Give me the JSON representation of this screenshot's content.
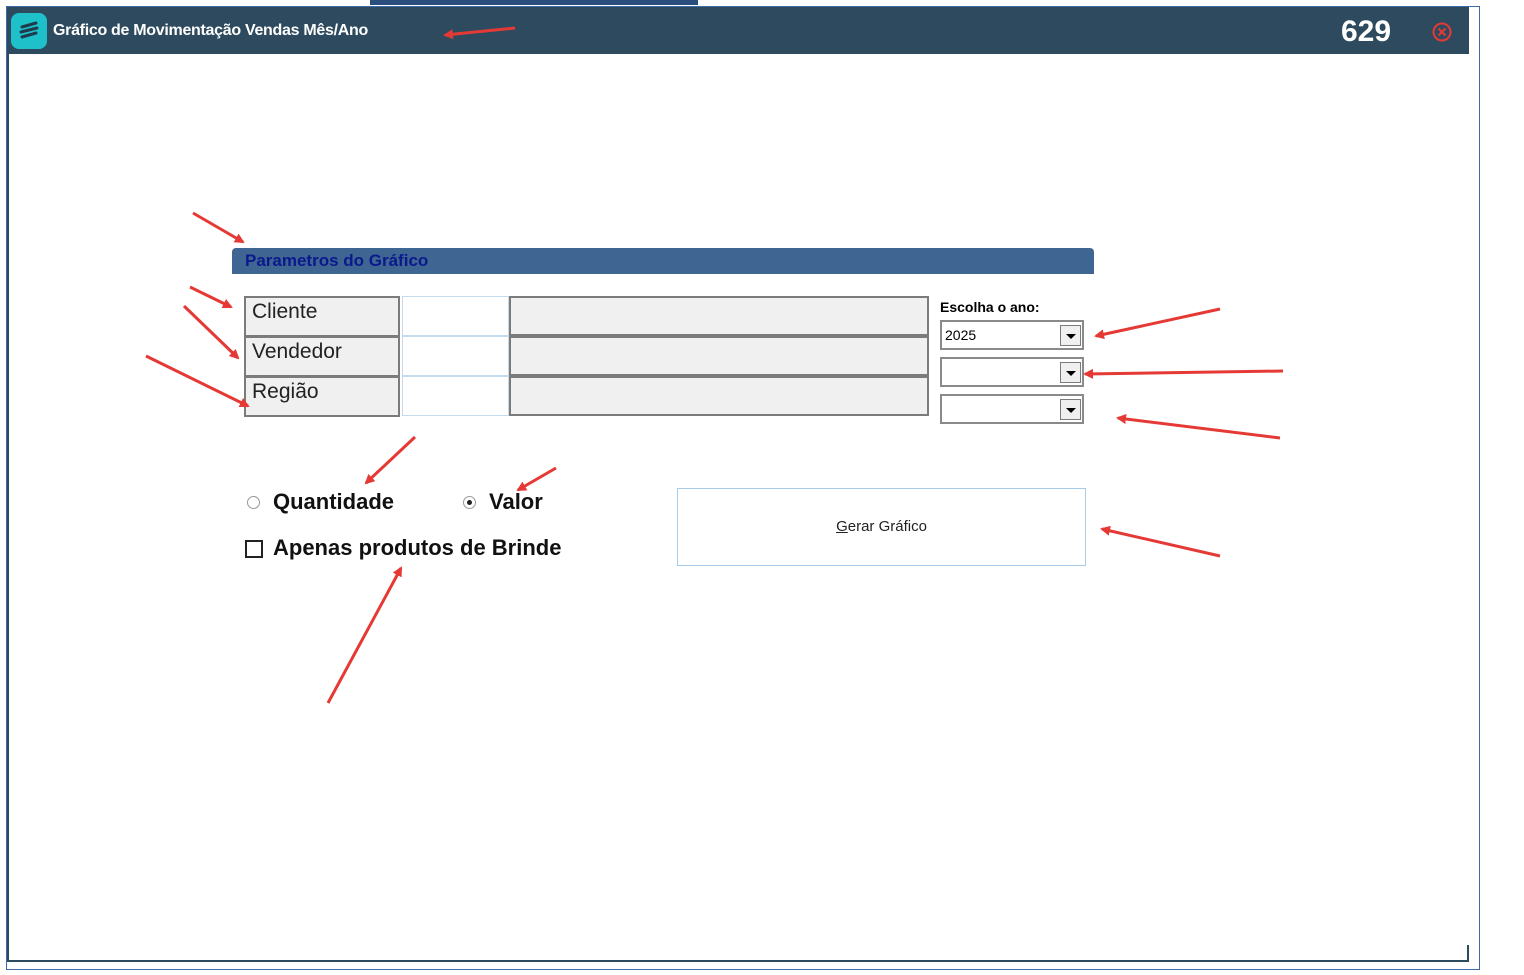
{
  "window": {
    "title": "Gráfico de Movimentação Vendas Mês/Ano",
    "number": "629",
    "icons": {
      "app": "app-logo-icon",
      "close": "close-circle-icon"
    }
  },
  "section": {
    "header": "Parametros do Gráfico"
  },
  "filters": [
    {
      "label": "Cliente",
      "code": "",
      "description": ""
    },
    {
      "label": "Vendedor",
      "code": "",
      "description": ""
    },
    {
      "label": "Região",
      "code": "",
      "description": ""
    }
  ],
  "year": {
    "label": "Escolha o ano:",
    "combo1_value": "2025",
    "combo2_value": "",
    "combo3_value": ""
  },
  "options": {
    "quantidade": "Quantidade",
    "valor": "Valor",
    "selected": "Valor",
    "brinde_label": "Apenas produtos de Brinde",
    "brinde_checked": false
  },
  "actions": {
    "generate_prefix": "G",
    "generate_rest": "erar Gráfico"
  },
  "colors": {
    "titlebar": "#2e4a5e",
    "app_icon": "#1ec1c9",
    "section_header": "#3f6593",
    "section_text": "#0a1a8c",
    "annotation_arrow": "#e53935"
  }
}
